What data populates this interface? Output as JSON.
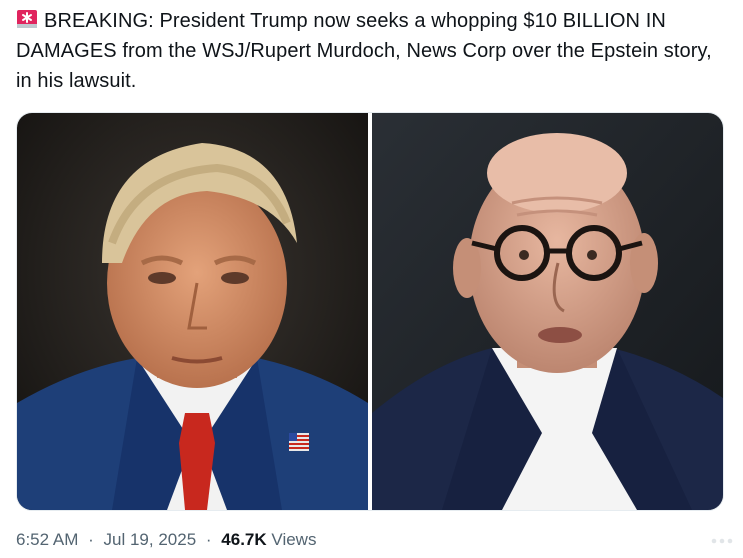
{
  "tweet": {
    "text": "BREAKING: President Trump now seeks a whopping $10 BILLION IN DAMAGES from the WSJ/Rupert Murdoch, News Corp over the Epstein story, in his lawsuit.",
    "leading_icon": "police-siren-emoji"
  },
  "media": {
    "left_photo": "portrait-man-blue-suit-red-tie",
    "right_photo": "portrait-elderly-man-glasses-navy-jacket"
  },
  "meta": {
    "time": "6:52 AM",
    "date": "Jul 19, 2025",
    "views_count": "46.7K",
    "views_label": "Views",
    "separator": "·"
  },
  "colors": {
    "text": "#0f1419",
    "secondary": "#536471",
    "siren_red": "#e0245e"
  }
}
